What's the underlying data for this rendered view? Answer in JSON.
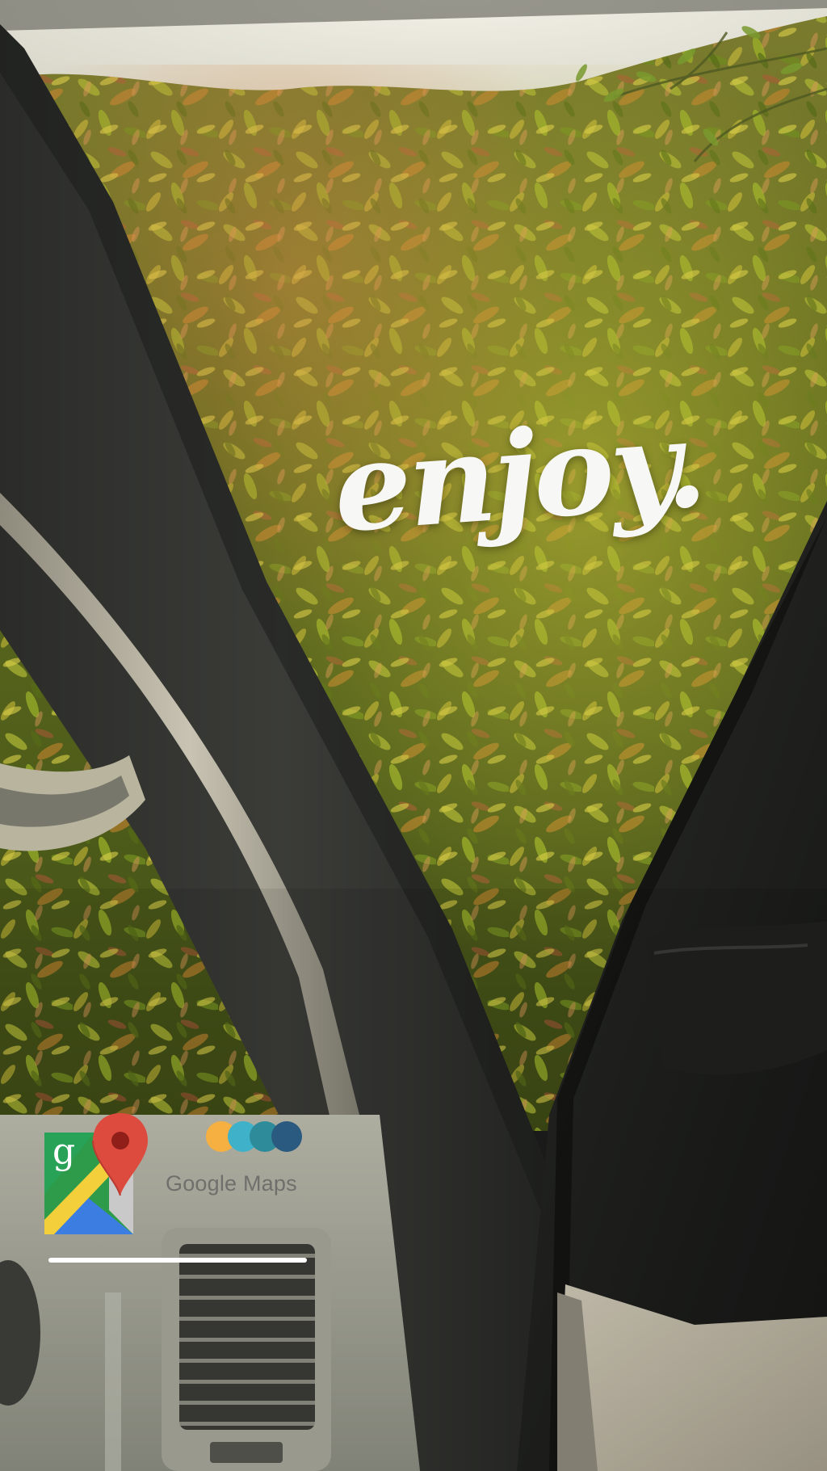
{
  "story": {
    "sticker_text": "enjoy.",
    "progress": 1.0
  },
  "maps_sticker": {
    "logo_letter": "g",
    "label": "Google Maps",
    "logo_icon": "google-maps-icon",
    "dot_colors": [
      "#f6b042",
      "#3fb1c9",
      "#2d8b9a",
      "#2a5a7f"
    ]
  }
}
